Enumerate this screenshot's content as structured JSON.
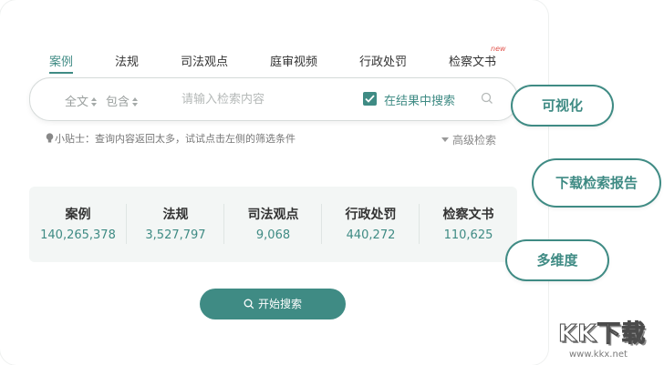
{
  "tabs": [
    {
      "label": "案例",
      "active": true
    },
    {
      "label": "法规"
    },
    {
      "label": "司法观点"
    },
    {
      "label": "庭审视频"
    },
    {
      "label": "行政处罚"
    },
    {
      "label": "检察文书"
    }
  ],
  "new_badge": "new",
  "search": {
    "scope_select": "全文",
    "match_select": "包含",
    "placeholder": "请输入检索内容",
    "value": "",
    "search_in_results_label": "在结果中搜索",
    "search_in_results_checked": true
  },
  "tips": "小贴士：查询内容返回太多，试试点击左侧的筛选条件",
  "advanced_search": "高级检索",
  "stats": [
    {
      "label": "案例",
      "value": "140,265,378"
    },
    {
      "label": "法规",
      "value": "3,527,797"
    },
    {
      "label": "司法观点",
      "value": "9,068"
    },
    {
      "label": "行政处罚",
      "value": "440,272"
    },
    {
      "label": "检察文书",
      "value": "110,625"
    }
  ],
  "start_button": "开始搜索",
  "features": [
    "可视化",
    "下载检索报告",
    "多维度"
  ],
  "watermark": {
    "logo": "KK下载",
    "url": "www.kkx.net"
  },
  "colors": {
    "accent": "#3f8b84",
    "badge": "#e1554e"
  }
}
